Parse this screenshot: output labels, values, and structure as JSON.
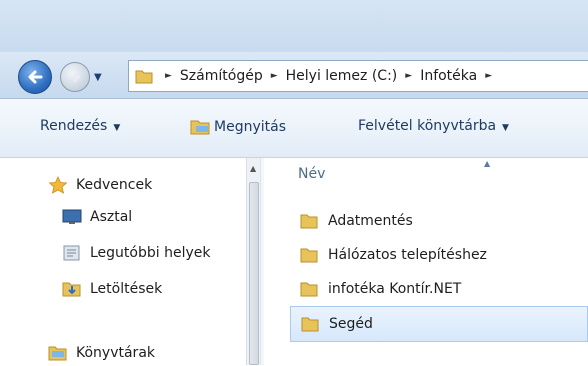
{
  "address": {
    "crumbs": [
      "Számítógép",
      "Helyi lemez (C:)",
      "Infotéka"
    ]
  },
  "toolbar": {
    "organize_label": "Rendezés",
    "open_label": "Megnyitás",
    "add_to_library_label": "Felvétel könyvtárba"
  },
  "nav": {
    "favorites_label": "Kedvencek",
    "desktop_label": "Asztal",
    "recent_label": "Legutóbbi helyek",
    "downloads_label": "Letöltések",
    "libraries_label": "Könyvtárak"
  },
  "files": {
    "column_name": "Név",
    "items": [
      "Adatmentés",
      "Hálózatos telepítéshez",
      "infotéka Kontír.NET",
      "Segéd"
    ],
    "selected": "Segéd"
  },
  "icons": {
    "back": "back-arrow-icon",
    "forward": "forward-arrow-icon",
    "folder": "folder-icon",
    "star": "star-icon",
    "desktop": "desktop-icon",
    "recent": "recent-places-icon",
    "downloads": "downloads-icon",
    "libraries": "libraries-icon"
  },
  "colors": {
    "folder": "#e7c35a",
    "selection": "#d6e8fb",
    "accent": "#2f6fc1"
  }
}
